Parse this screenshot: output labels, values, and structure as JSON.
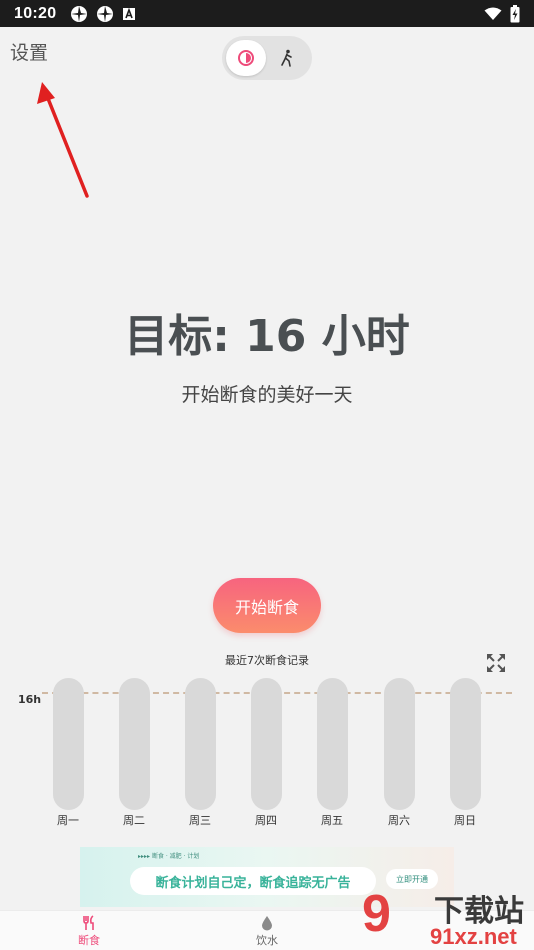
{
  "status_bar": {
    "time": "10:20"
  },
  "header": {
    "settings_label": "设置"
  },
  "mode_toggle": {
    "active": "fasting",
    "options": [
      "fasting-icon",
      "walking-icon"
    ],
    "accent": "#ee4b7a"
  },
  "goal": {
    "title": "目标: 16 小时",
    "subtitle": "开始断食的美好一天"
  },
  "start_button": {
    "label": "开始断食"
  },
  "records": {
    "title": "最近7次断食记录",
    "goal_line_label": "16h",
    "days": [
      "周一",
      "周二",
      "周三",
      "周四",
      "周五",
      "周六",
      "周日"
    ]
  },
  "ad": {
    "tag": "▸▸▸▸  断食 · 减肥 · 计划",
    "text": "断食计划自己定，断食追踪无广告",
    "cta": "立即开通"
  },
  "tabs": [
    {
      "label": "断食",
      "icon": "fork-knife-icon",
      "active": true
    },
    {
      "label": "饮水",
      "icon": "water-drop-icon",
      "active": false
    }
  ],
  "watermark": {
    "big": "9",
    "cn": "下载站",
    "url": "91xz.net"
  },
  "colors": {
    "accent": "#ee4b7a",
    "bar": "#d9d9d9",
    "goal_line": "#d0b9a3",
    "annotation_arrow": "#e02020"
  }
}
